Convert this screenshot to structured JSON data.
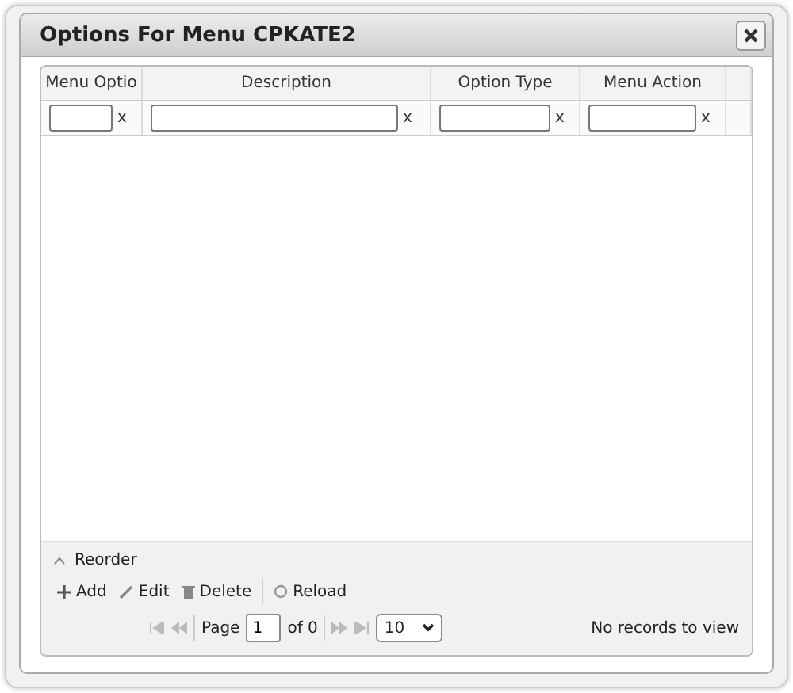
{
  "dialog": {
    "title": "Options For Menu CPKATE2"
  },
  "table": {
    "columns": [
      {
        "label": "Menu Optio",
        "clear": "x"
      },
      {
        "label": "Description",
        "clear": "x"
      },
      {
        "label": "Option Type",
        "clear": "x"
      },
      {
        "label": "Menu Action",
        "clear": "x"
      }
    ]
  },
  "reorder": {
    "label": "Reorder"
  },
  "toolbar": [
    {
      "kind": "add",
      "label": "Add"
    },
    {
      "kind": "edit",
      "label": "Edit"
    },
    {
      "kind": "delete",
      "label": "Delete"
    },
    {
      "kind": "reload",
      "label": "Reload"
    }
  ],
  "pager": {
    "page_label": "Page",
    "page": "1",
    "of": "of 0",
    "page_size": "10",
    "status": "No records to view"
  }
}
